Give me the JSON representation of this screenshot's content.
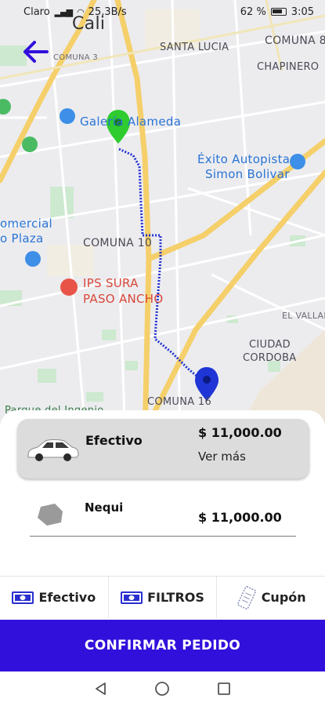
{
  "status_bar": {
    "carrier": "Claro",
    "speed": "25,3B/s",
    "battery_percent": "62 %",
    "time": "3:05"
  },
  "map": {
    "labels": {
      "city": "Cali",
      "comuna_3": "COMUNA 3",
      "santa_lucia": "SANTA LUCIA",
      "comuna_8": "COMUNA 8",
      "chapinero": "CHAPINERO",
      "galeria": "Galería Alameda",
      "exito_line1": "Éxito Autopista",
      "exito_line2": "Simon Bolivar",
      "comercial_line1": "omercial",
      "comercial_line2": "o Plaza",
      "comuna_10": "COMUNA 10",
      "ips_line1": "IPS SURA",
      "ips_line2": "PASO ANCHO",
      "el_vallado": "EL VALLADO",
      "ciudad_line1": "CIUDAD",
      "ciudad_line2": "CORDOBA",
      "parque": "Parque del Ingenio",
      "comuna_16": "COMUNA 16"
    },
    "colors": {
      "origin_pin": "#2ecc2e",
      "destination_pin": "#1f35d6",
      "route": "#2130d0"
    }
  },
  "payment_options": [
    {
      "name": "Efectivo",
      "price": "$ 11,000.00",
      "more": "Ver más",
      "icon": "car-icon"
    },
    {
      "name": "Nequi",
      "price": "$ 11,000.00",
      "icon": "nequi-icon"
    }
  ],
  "tabs": [
    {
      "label": "Efectivo",
      "icon": "cash-icon"
    },
    {
      "label": "FILTROS",
      "icon": "cash-icon"
    },
    {
      "label": "Cupón",
      "icon": "coupon-icon"
    }
  ],
  "confirm_label": "CONFIRMAR PEDIDO",
  "accent_color": "#3210dc"
}
